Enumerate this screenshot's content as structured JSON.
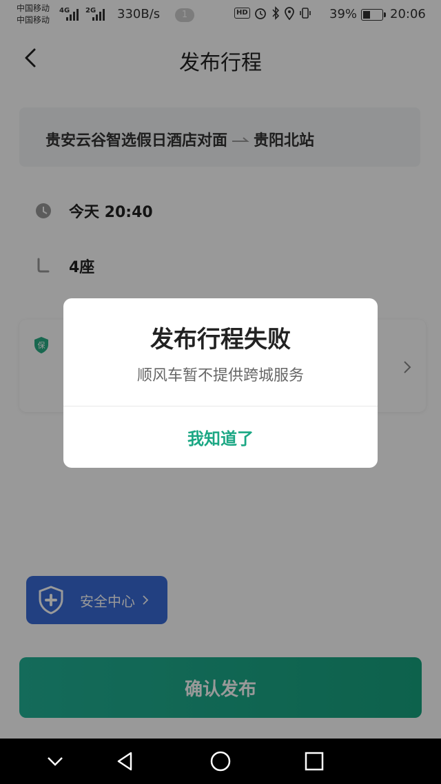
{
  "statusbar": {
    "carrier1": "中国移动",
    "carrier2": "中国移动",
    "signal1_label": "4G",
    "signal2_label": "2G",
    "net_speed": "330B/s",
    "notification_count": "1",
    "hd_label": "HD",
    "battery_percent": "39%",
    "time": "20:06"
  },
  "header": {
    "title": "发布行程"
  },
  "route": {
    "from": "贵安云谷智选假日酒店对面",
    "to": "贵阳北站"
  },
  "trip": {
    "time": "今天 20:40",
    "seats": "4座"
  },
  "insurance": {
    "badge": "保"
  },
  "safety": {
    "label": "安全中心"
  },
  "confirm": {
    "label": "确认发布"
  },
  "dialog": {
    "title": "发布行程失败",
    "message": "顺风车暂不提供跨城服务",
    "button": "我知道了"
  },
  "colors": {
    "accent": "#1ba784",
    "safety_blue": "#3a6cd8"
  }
}
